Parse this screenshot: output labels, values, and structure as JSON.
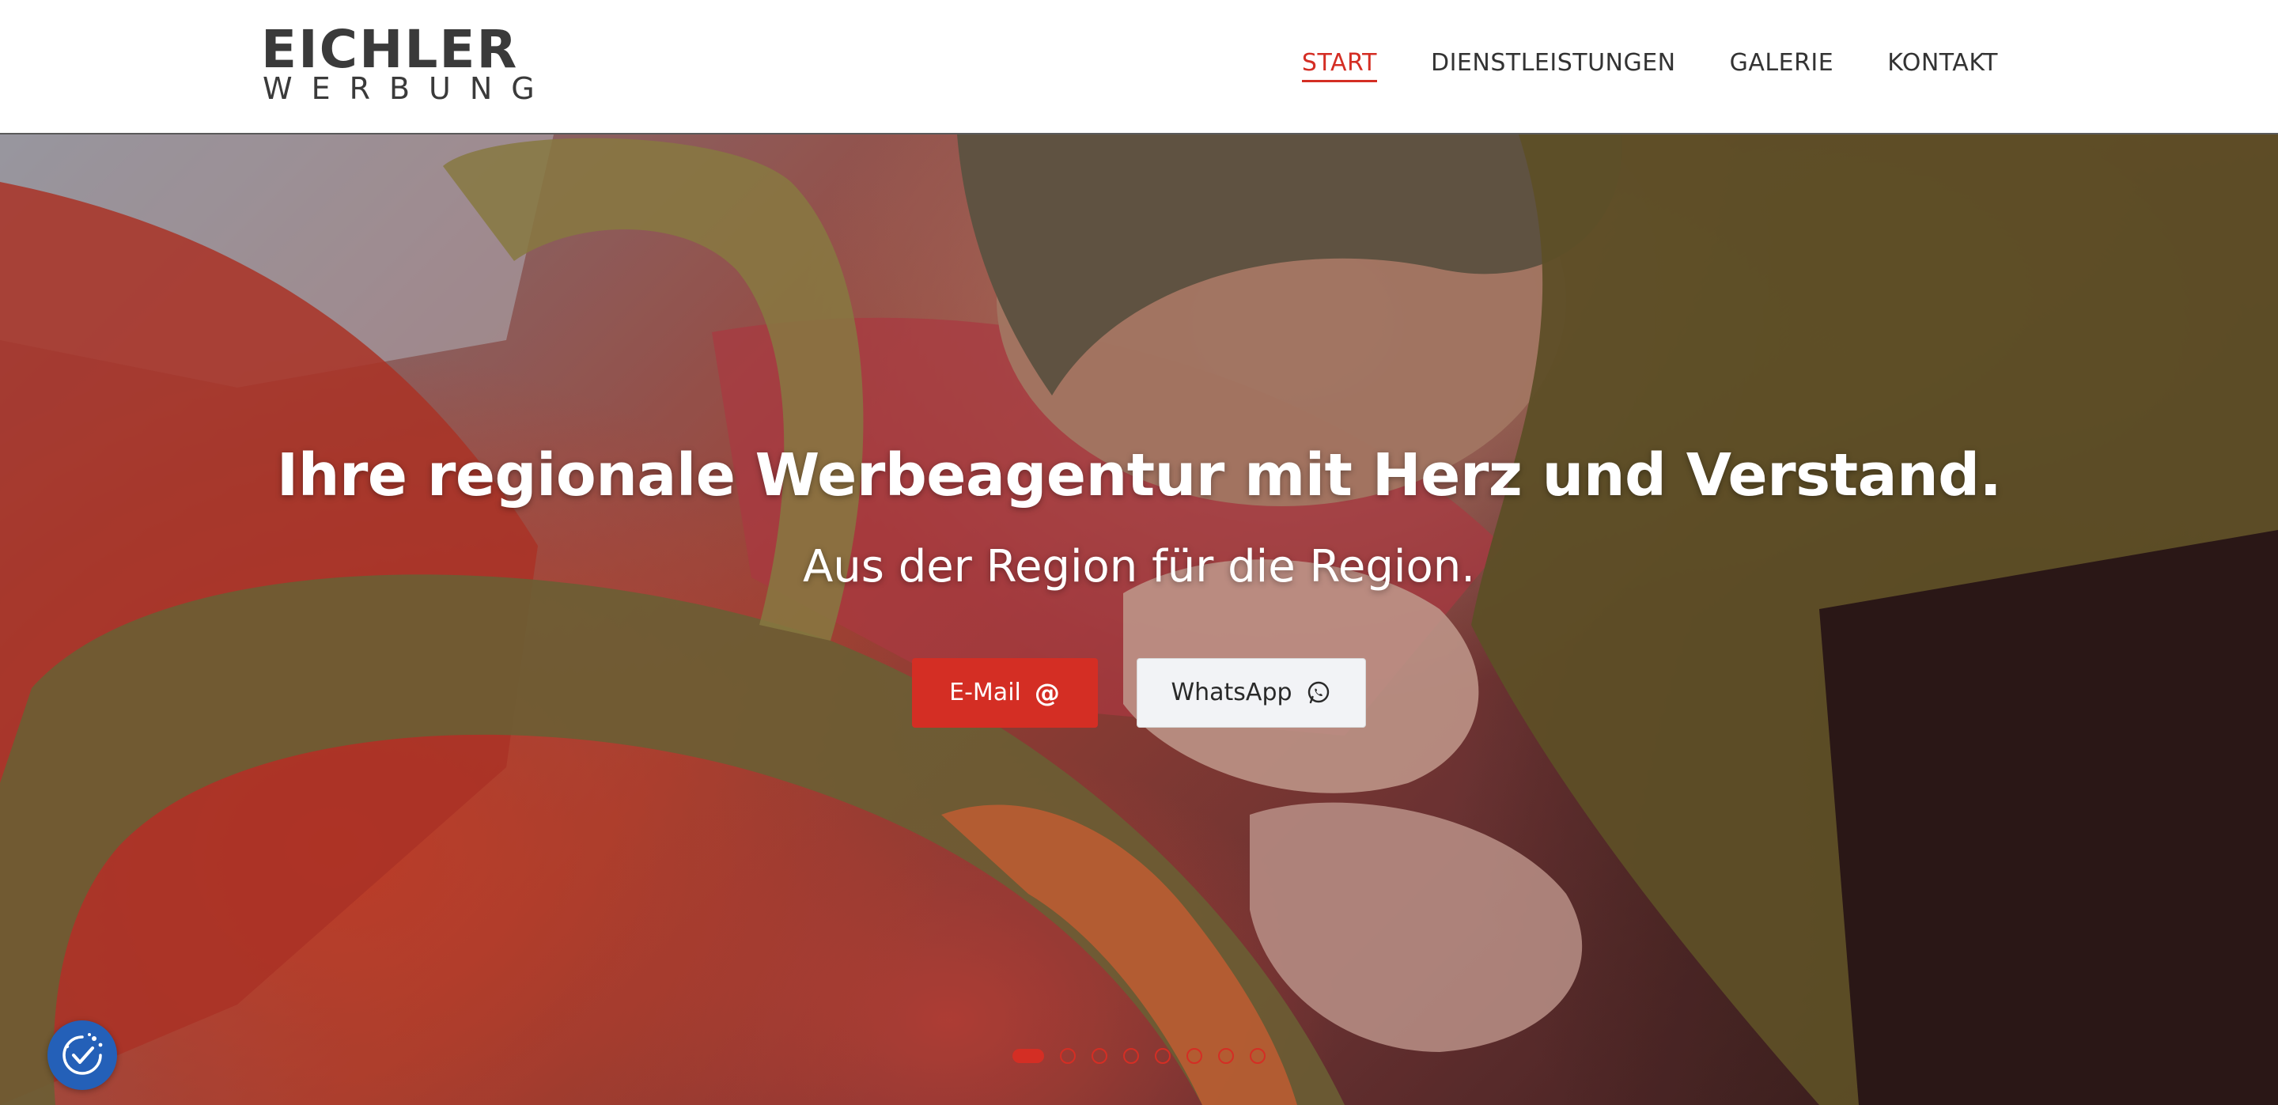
{
  "brand": {
    "logo_top": "EICHLER",
    "logo_bottom": "WERBUNG"
  },
  "nav": {
    "items": [
      {
        "label": "START",
        "active": true
      },
      {
        "label": "DIENSTLEISTUNGEN",
        "active": false
      },
      {
        "label": "GALERIE",
        "active": false
      },
      {
        "label": "KONTAKT",
        "active": false
      }
    ]
  },
  "hero": {
    "title": "Ihre regionale Werbeagentur mit Herz und Verstand.",
    "subtitle": "Aus der Region für die Region.",
    "buttons": {
      "email_label": "E-Mail",
      "email_icon": "at-icon",
      "whatsapp_label": "WhatsApp",
      "whatsapp_icon": "whatsapp-icon"
    },
    "slides": {
      "count": 8,
      "active_index": 0
    }
  },
  "consent": {
    "icon": "cookie-consent-icon"
  },
  "colors": {
    "accent": "#d42e24",
    "text_dark": "#333333",
    "consent_blue": "#2460b8",
    "whatsapp_button_bg": "#f2f3f6"
  }
}
